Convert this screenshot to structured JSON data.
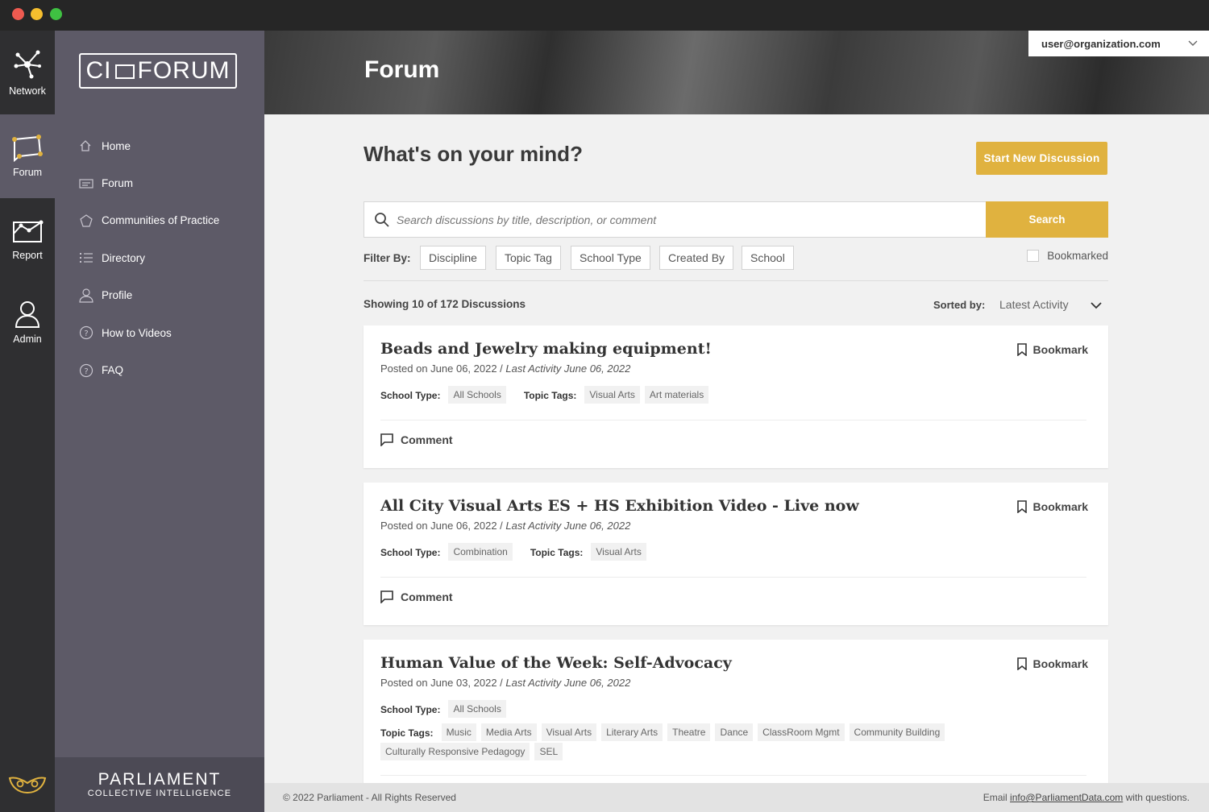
{
  "rail": {
    "items": [
      {
        "label": "Network",
        "icon": "network-icon"
      },
      {
        "label": "Forum",
        "icon": "forum-icon"
      },
      {
        "label": "Report",
        "icon": "report-icon"
      },
      {
        "label": "Admin",
        "icon": "admin-icon"
      }
    ]
  },
  "brand": {
    "left": "CI",
    "right": "FORUM"
  },
  "nav": {
    "items": [
      {
        "label": "Home",
        "icon": "home-icon"
      },
      {
        "label": "Forum",
        "icon": "forum-list-icon"
      },
      {
        "label": "Communities of Practice",
        "icon": "communities-icon"
      },
      {
        "label": "Directory",
        "icon": "directory-icon"
      },
      {
        "label": "Profile",
        "icon": "profile-icon"
      },
      {
        "label": "How to Videos",
        "icon": "help-circle-icon"
      },
      {
        "label": "FAQ",
        "icon": "help-circle-icon"
      }
    ]
  },
  "sidebar_footer": {
    "main": "PARLIAMENT",
    "sub": "COLLECTIVE INTELLIGENCE"
  },
  "header": {
    "title": "Forum",
    "user": "user@organization.com"
  },
  "main": {
    "heading": "What's on your mind?",
    "start_button": "Start New Discussion",
    "search_placeholder": "Search discussions by title, description, or comment",
    "search_button": "Search",
    "filter_label": "Filter By:",
    "filters": [
      "Discipline",
      "Topic Tag",
      "School Type",
      "Created By",
      "School"
    ],
    "bookmarked_label": "Bookmarked",
    "showing": "Showing 10 of 172 Discussions",
    "sorted_label": "Sorted by:",
    "sorted_value": "Latest Activity"
  },
  "labels": {
    "bookmark": "Bookmark",
    "comment": "Comment",
    "school_type": "School Type:",
    "topic_tags": "Topic Tags:"
  },
  "discussions": [
    {
      "title": "Beads and Jewelry making equipment!",
      "posted": "Posted on June 06, 2022 / ",
      "activity": "Last Activity June 06, 2022",
      "school_type": "All Schools",
      "tags": [
        "Visual Arts",
        "Art materials"
      ]
    },
    {
      "title": "All City Visual Arts ES + HS Exhibition Video - Live now",
      "posted": "Posted on June 06, 2022 / ",
      "activity": "Last Activity June 06, 2022",
      "school_type": "Combination",
      "tags": [
        "Visual Arts"
      ]
    },
    {
      "title": "Human Value of the Week: Self-Advocacy",
      "posted": "Posted on June 03, 2022 / ",
      "activity": "Last Activity June 06, 2022",
      "school_type": "All Schools",
      "tags": [
        "Music",
        "Media Arts",
        "Visual Arts",
        "Literary Arts",
        "Theatre",
        "Dance",
        "ClassRoom Mgmt",
        "Community Building",
        "Culturally Responsive Pedagogy",
        "SEL"
      ]
    }
  ],
  "footer": {
    "copyright": "© 2022 Parliament - All Rights Reserved",
    "email_prefix": "Email ",
    "email": "info@ParliamentData.com",
    "email_suffix": " with questions."
  },
  "colors": {
    "accent": "#e0b23f",
    "sidebar": "#5d5a67",
    "rail": "#2f2f31"
  }
}
